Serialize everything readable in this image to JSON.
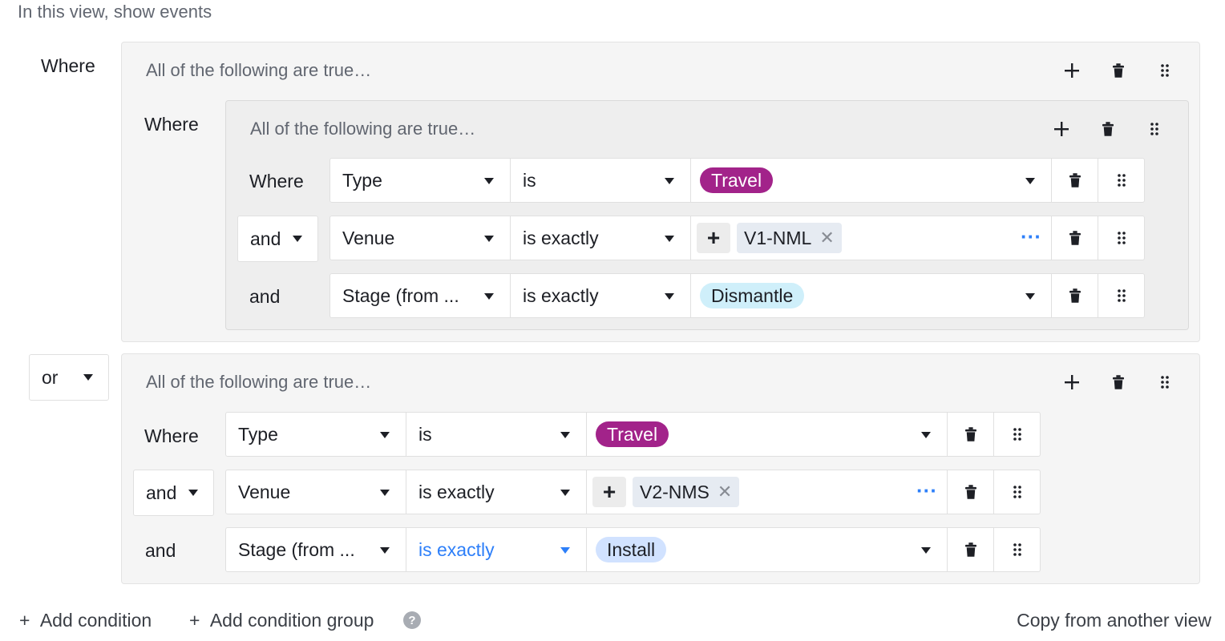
{
  "header": "In this view, show events",
  "labels": {
    "where": "Where",
    "and": "and",
    "or": "or"
  },
  "group_title": "All of the following are true…",
  "colors": {
    "travel": "#a2238a",
    "dismantle": "#cfeffa",
    "install": "#d1e2ff",
    "accent": "#2d7ff9"
  },
  "group1": {
    "inner": {
      "rows": [
        {
          "conj": "Where",
          "field": "Type",
          "op": "is",
          "value": "Travel"
        },
        {
          "conj": "and",
          "field": "Venue",
          "op": "is exactly",
          "value": "V1-NML"
        },
        {
          "conj": "and",
          "field": "Stage (from ...",
          "op": "is exactly",
          "value": "Dismantle"
        }
      ]
    }
  },
  "group2": {
    "conj": "or",
    "rows": [
      {
        "conj": "Where",
        "field": "Type",
        "op": "is",
        "value": "Travel"
      },
      {
        "conj": "and",
        "field": "Venue",
        "op": "is exactly",
        "value": "V2-NMS"
      },
      {
        "conj": "and",
        "field": "Stage (from ...",
        "op": "is exactly",
        "value": "Install"
      }
    ]
  },
  "icons": {
    "add": "plus-icon",
    "delete": "trash-icon",
    "drag": "drag-handle-icon",
    "remove": "close-icon",
    "more": "more-dots-icon",
    "dropdown": "caret-down-icon",
    "help": "help-icon"
  },
  "footer": {
    "add_condition": "Add condition",
    "add_group": "Add condition group",
    "copy": "Copy from another view",
    "plus": "+",
    "help": "?"
  }
}
